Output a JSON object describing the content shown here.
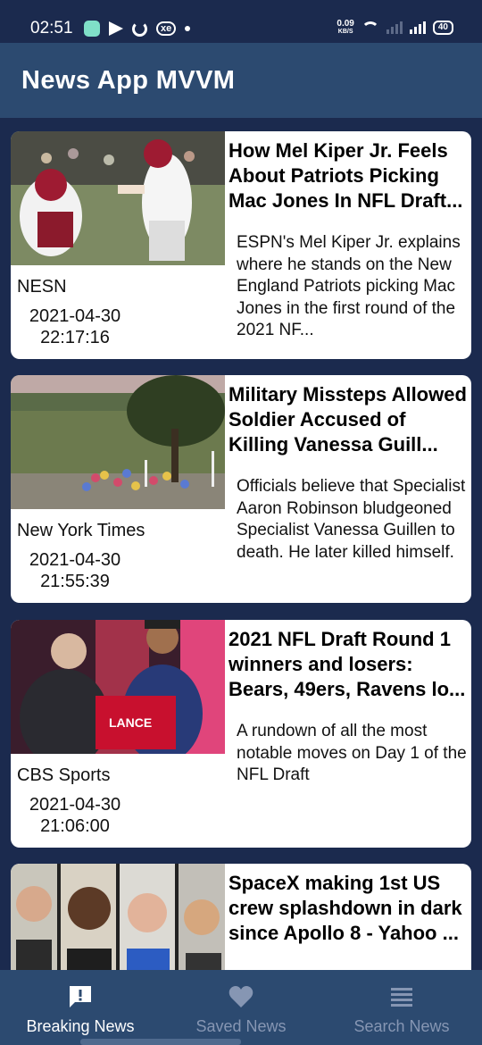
{
  "status_bar": {
    "time": "02:51",
    "net_speed_value": "0.09",
    "net_speed_unit": "KB/S",
    "battery": "40"
  },
  "app_bar": {
    "title": "News App MVVM"
  },
  "articles": [
    {
      "title": "How Mel Kiper Jr. Feels About Patriots Picking Mac Jones In NFL Draft...",
      "description": "ESPN's Mel Kiper Jr. explains where he stands on the New England Patriots picking Mac Jones in the first round of the 2021 NF...",
      "source": "NESN",
      "date": "2021-04-30",
      "time": "22:17:16",
      "image_icon": "football-photo"
    },
    {
      "title": "Military Missteps Allowed Soldier Accused of Killing Vanessa Guill...",
      "description": "Officials believe that Specialist Aaron Robinson bludgeoned Specialist Vanessa Guillen to death. He later killed himself.",
      "source": "New York Times",
      "date": "2021-04-30",
      "time": "21:55:39",
      "image_icon": "memorial-photo"
    },
    {
      "title": "2021 NFL Draft Round 1 winners and losers: Bears, 49ers, Ravens lo...",
      "description": "A rundown of all the most notable moves on Day 1 of the NFL Draft",
      "source": "CBS Sports",
      "date": "2021-04-30",
      "time": "21:06:00",
      "image_icon": "draft-photo",
      "jersey_text": "LANCE"
    },
    {
      "title": "SpaceX making 1st US crew splashdown in dark since Apollo 8 - Yahoo ...",
      "description": "",
      "source": "",
      "date": "",
      "time": "",
      "image_icon": "crew-photo"
    }
  ],
  "bottom_nav": {
    "items": [
      {
        "label": "Breaking News",
        "icon": "alert-icon",
        "active": true
      },
      {
        "label": "Saved News",
        "icon": "heart-icon",
        "active": false
      },
      {
        "label": "Search News",
        "icon": "list-icon",
        "active": false
      }
    ]
  },
  "colors": {
    "background": "#1b2a4e",
    "app_bar": "#2c4a70",
    "nav_active": "#ffffff",
    "nav_inactive": "#8696b3"
  }
}
